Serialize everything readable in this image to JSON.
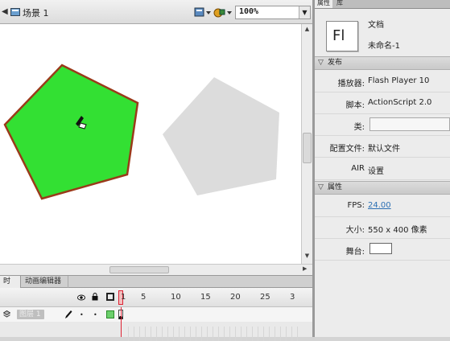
{
  "toolbar": {
    "scene_label": "场景 1",
    "zoom_value": "100%"
  },
  "stage": {
    "background": "#ffffff",
    "shapes": [
      {
        "name": "selected-pentagon",
        "fill": "#33e033",
        "stroke": "#9a3a1a"
      },
      {
        "name": "gray-pentagon",
        "fill": "#dcdcdc",
        "stroke": "none"
      }
    ]
  },
  "timeline": {
    "tabs": [
      {
        "label": "时间轴"
      },
      {
        "label": "动画编辑器"
      }
    ],
    "frame_numbers": [
      "1",
      "5",
      "10",
      "15",
      "20",
      "25",
      "3"
    ],
    "layer": {
      "name": "图层 1"
    }
  },
  "properties": {
    "tabs": [
      {
        "label": "属性"
      },
      {
        "label": "库"
      }
    ],
    "doc_icon_text": "Fl",
    "doc_type": "文档",
    "doc_name": "未命名-1",
    "publish_section": "发布",
    "player_label": "播放器:",
    "player_value": "Flash Player 10",
    "script_label": "脚本:",
    "script_value": "ActionScript 2.0",
    "class_label": "类:",
    "profile_label": "配置文件:",
    "profile_value": "默认文件",
    "air_label": "AIR",
    "air_value": "设置",
    "props_section": "属性",
    "fps_label": "FPS:",
    "fps_value": "24.00",
    "size_label": "大小:",
    "size_value": "550 x 400 像素",
    "stage_label": "舞台:"
  },
  "colors": {
    "accent_link": "#2b6fb3",
    "playhead": "#dd2233",
    "pentagon_fill": "#33e033",
    "pentagon_stroke": "#9a3a1a"
  }
}
